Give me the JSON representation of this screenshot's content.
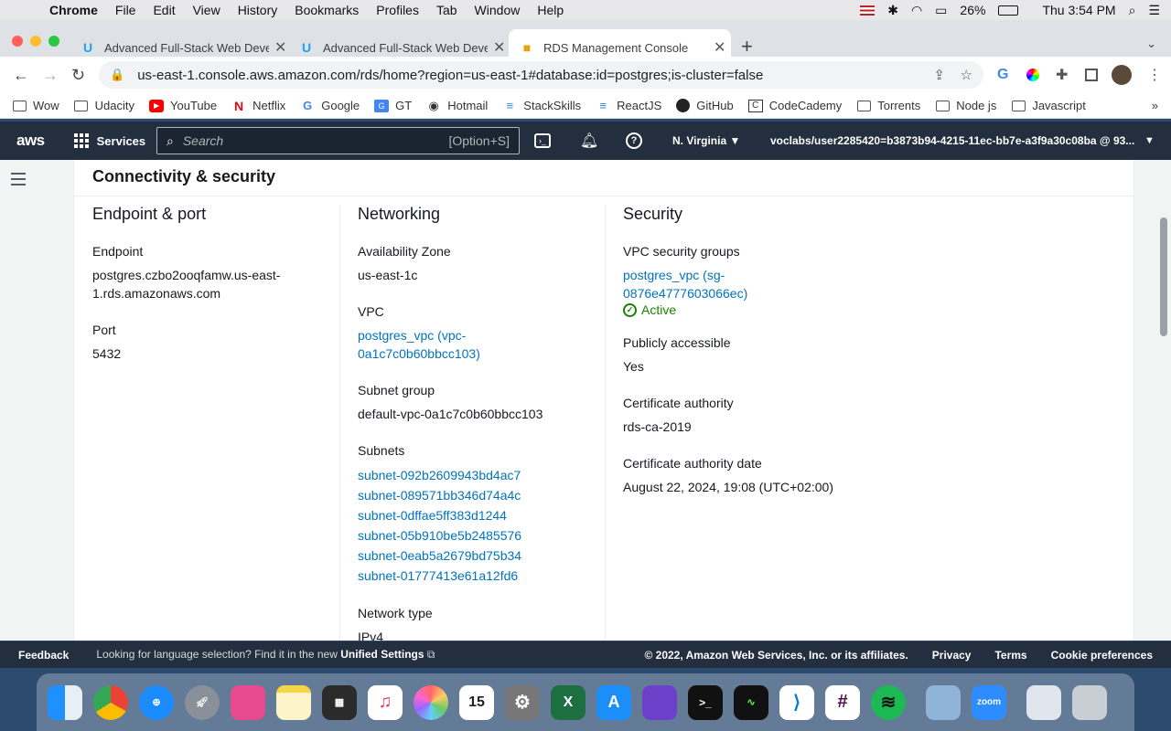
{
  "mac_menu": {
    "app": "Chrome",
    "items": [
      "File",
      "Edit",
      "View",
      "History",
      "Bookmarks",
      "Profiles",
      "Tab",
      "Window",
      "Help"
    ],
    "battery": "26%",
    "clock": "Thu 3:54 PM"
  },
  "tabs": [
    {
      "title": "Advanced Full-Stack Web Deve"
    },
    {
      "title": "Advanced Full-Stack Web Deve"
    },
    {
      "title": "RDS Management Console"
    }
  ],
  "address": {
    "url": "us-east-1.console.aws.amazon.com/rds/home?region=us-east-1#database:id=postgres;is-cluster=false"
  },
  "bookmarks": [
    "Wow",
    "Udacity",
    "YouTube",
    "Netflix",
    "Google",
    "GT",
    "Hotmail",
    "StackSkills",
    "ReactJS",
    "GitHub",
    "CodeCademy",
    "Torrents",
    "Node js",
    "Javascript"
  ],
  "aws_nav": {
    "logo": "aws",
    "services": "Services",
    "search_placeholder": "Search",
    "search_shortcut": "[Option+S]",
    "region": "N. Virginia ▼",
    "account": "voclabs/user2285420=b3873b94-4215-11ec-bb7e-a3f9a30c08ba @ 93..."
  },
  "section": {
    "title": "Connectivity & security",
    "endpoint_port": {
      "heading": "Endpoint & port",
      "endpoint_label": "Endpoint",
      "endpoint_value": "postgres.czbo2ooqfamw.us-east-1.rds.amazonaws.com",
      "port_label": "Port",
      "port_value": "5432"
    },
    "networking": {
      "heading": "Networking",
      "az_label": "Availability Zone",
      "az_value": "us-east-1c",
      "vpc_label": "VPC",
      "vpc_value": "postgres_vpc (vpc-0a1c7c0b60bbcc103)",
      "subnet_group_label": "Subnet group",
      "subnet_group_value": "default-vpc-0a1c7c0b60bbcc103",
      "subnets_label": "Subnets",
      "subnets": [
        "subnet-092b2609943bd4ac7",
        "subnet-089571bb346d74a4c",
        "subnet-0dffae5ff383d1244",
        "subnet-05b910be5b2485576",
        "subnet-0eab5a2679bd75b34",
        "subnet-01777413e61a12fd6"
      ],
      "network_type_label": "Network type",
      "network_type_value": "IPv4"
    },
    "security": {
      "heading": "Security",
      "sg_label": "VPC security groups",
      "sg_value": "postgres_vpc (sg-0876e4777603066ec)",
      "sg_status": "Active",
      "public_label": "Publicly accessible",
      "public_value": "Yes",
      "ca_label": "Certificate authority",
      "ca_value": "rds-ca-2019",
      "ca_date_label": "Certificate authority date",
      "ca_date_value": "August 22, 2024, 19:08 (UTC+02:00)"
    }
  },
  "footer": {
    "feedback": "Feedback",
    "lang_text": "Looking for language selection? Find it in the new",
    "lang_link": "Unified Settings",
    "copyright": "© 2022, Amazon Web Services, Inc. or its affiliates.",
    "privacy": "Privacy",
    "terms": "Terms",
    "cookies": "Cookie preferences"
  },
  "colors": {
    "aws_nav": "#232f3e",
    "link": "#0073bb",
    "success": "#1d8102"
  }
}
